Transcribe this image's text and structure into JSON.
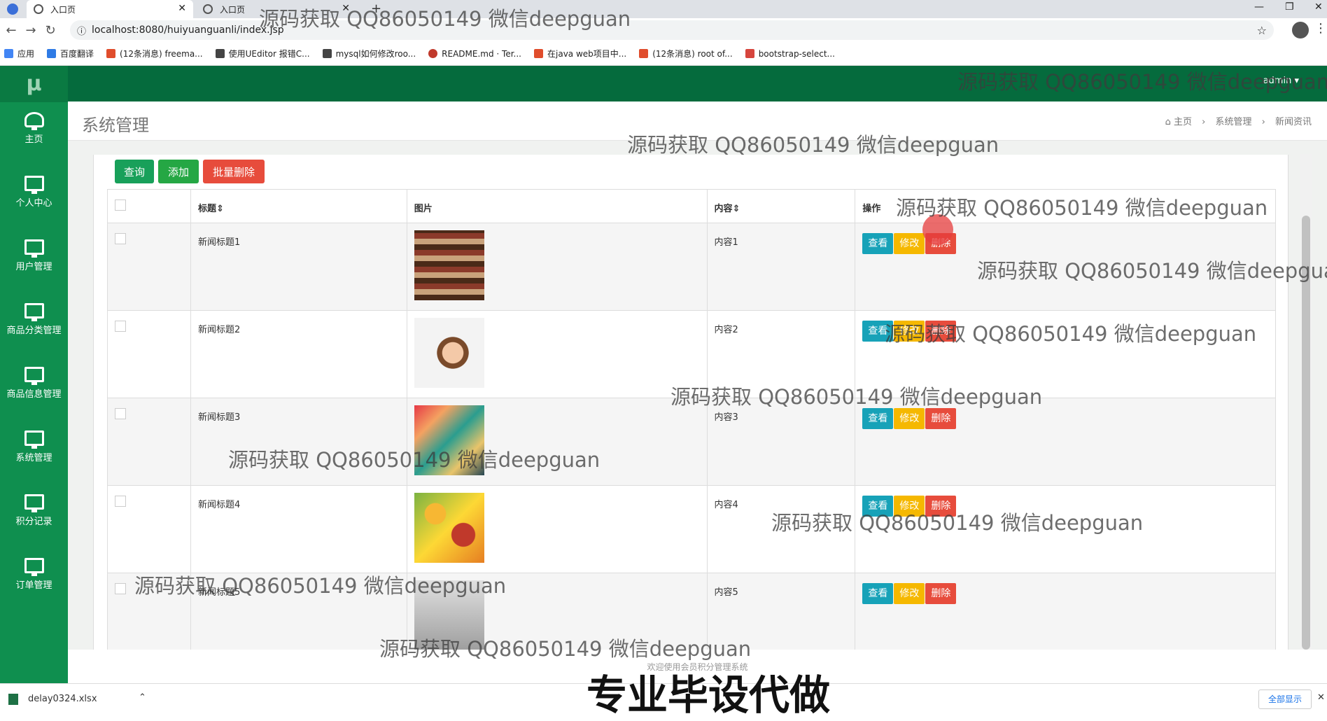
{
  "browser": {
    "tabs": [
      {
        "label": "入口页"
      },
      {
        "label": "入口页"
      }
    ],
    "url": "localhost:8080/huiyuanguanli/index.jsp",
    "bookmarks": [
      {
        "label": "应用"
      },
      {
        "label": "百度翻译"
      },
      {
        "label": "(12条消息) freema..."
      },
      {
        "label": "使用UEditor 报错C..."
      },
      {
        "label": "mysql如何修改roo..."
      },
      {
        "label": "README.md · Ter..."
      },
      {
        "label": "在java web项目中..."
      },
      {
        "label": "(12条消息) root of..."
      },
      {
        "label": "bootstrap-select..."
      }
    ]
  },
  "sidebar": {
    "logo": "μ",
    "items": [
      {
        "label": "主页",
        "icon": "dashboard-icon"
      },
      {
        "label": "个人中心",
        "icon": "monitor-icon"
      },
      {
        "label": "用户管理",
        "icon": "monitor-icon"
      },
      {
        "label": "商品分类管理",
        "icon": "monitor-icon"
      },
      {
        "label": "商品信息管理",
        "icon": "monitor-icon"
      },
      {
        "label": "系统管理",
        "icon": "monitor-icon"
      },
      {
        "label": "积分记录",
        "icon": "monitor-icon"
      },
      {
        "label": "订单管理",
        "icon": "monitor-icon"
      }
    ]
  },
  "header": {
    "user": "admin"
  },
  "page": {
    "title": "系统管理",
    "breadcrumb": [
      "主页",
      "系统管理",
      "新闻资讯"
    ]
  },
  "toolbar": {
    "query": "查询",
    "add": "添加",
    "batch_delete": "批量删除"
  },
  "table": {
    "columns": [
      "标题",
      "图片",
      "内容",
      "操作"
    ],
    "rows": [
      {
        "title": "新闻标题1",
        "content": "内容1"
      },
      {
        "title": "新闻标题2",
        "content": "内容2"
      },
      {
        "title": "新闻标题3",
        "content": "内容3"
      },
      {
        "title": "新闻标题4",
        "content": "内容4"
      },
      {
        "title": "新闻标题5",
        "content": "内容5"
      }
    ],
    "actions": {
      "view": "查看",
      "edit": "修改",
      "delete": "删除"
    }
  },
  "footer": {
    "text": "欢迎使用会员积分管理系统"
  },
  "download": {
    "file": "delay0324.xlsx",
    "show_all": "全部显示"
  },
  "watermark": {
    "text": "源码获取 QQ86050149 微信deepguan",
    "banner": "专业毕设代做"
  },
  "colors": {
    "sidebar": "#0f8f4f",
    "topnav": "#056b3d",
    "view": "#17a2b8",
    "edit": "#f5b800",
    "delete": "#e74c3c",
    "query": "#18a05a",
    "add": "#25a744",
    "batch_delete": "#e74c3c"
  }
}
